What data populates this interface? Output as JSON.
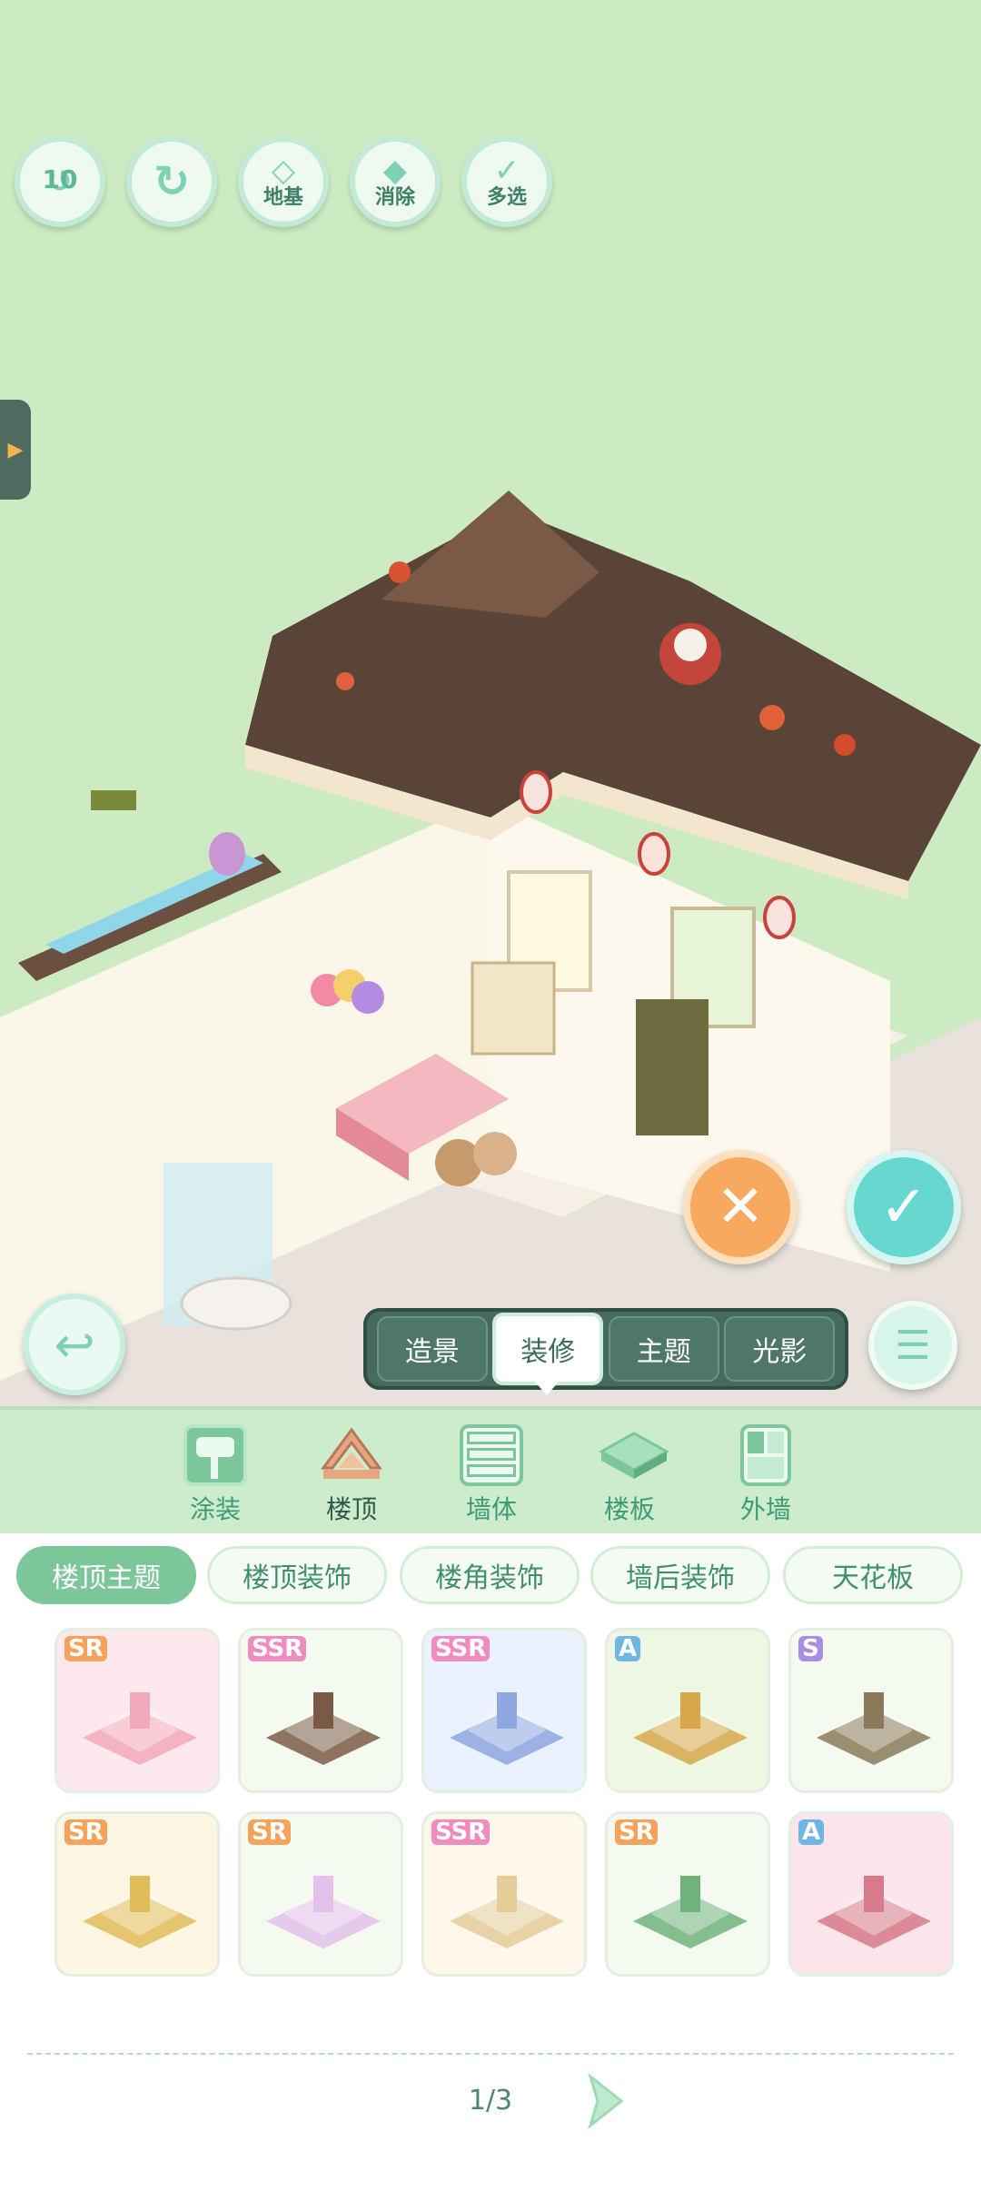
{
  "top_toolbar": {
    "undo_count": "10",
    "foundation_label": "地基",
    "erase_label": "消除",
    "multi_select_label": "多选"
  },
  "modes": [
    "造景",
    "装修",
    "主题",
    "光影"
  ],
  "active_mode": "装修",
  "categories": [
    "涂装",
    "楼顶",
    "墙体",
    "楼板",
    "外墙"
  ],
  "active_category": "楼顶",
  "sub_tabs": [
    "楼顶主题",
    "楼顶装饰",
    "楼角装饰",
    "墙后装饰",
    "天花板"
  ],
  "active_sub_tab": "楼顶主题",
  "items": [
    {
      "rarity": "SR",
      "rarity_color": "#f5a35c",
      "bg": "#fde8ee",
      "icon": "pink-castle-roof"
    },
    {
      "rarity": "SSR",
      "rarity_color": "#f08cc0",
      "bg": "#f4faef",
      "icon": "wooden-bridge-roof"
    },
    {
      "rarity": "SSR",
      "rarity_color": "#f08cc0",
      "bg": "#eaf2fd",
      "icon": "blue-crystal-roof"
    },
    {
      "rarity": "A",
      "rarity_color": "#6fb6e6",
      "bg": "#eef7e2",
      "icon": "gramophone-garden"
    },
    {
      "rarity": "S",
      "rarity_color": "#a98ee0",
      "bg": "#f4faef",
      "icon": "green-pavilion-roof"
    },
    {
      "rarity": "SR",
      "rarity_color": "#f5a35c",
      "bg": "#fdf6e3",
      "icon": "golden-tower-roof"
    },
    {
      "rarity": "SR",
      "rarity_color": "#f5a35c",
      "bg": "#f4faef",
      "icon": "pastel-moon-roof"
    },
    {
      "rarity": "SSR",
      "rarity_color": "#f08cc0",
      "bg": "#fdf7ec",
      "icon": "cream-cloud-roof"
    },
    {
      "rarity": "SR",
      "rarity_color": "#f5a35c",
      "bg": "#f4faef",
      "icon": "tropical-island-roof"
    },
    {
      "rarity": "A",
      "rarity_color": "#6fb6e6",
      "bg": "#fbe4ea",
      "icon": "cherry-blossom-roof"
    }
  ],
  "pagination": {
    "text": "1/3"
  },
  "colors": {
    "background": "#cdebc2",
    "accent_green": "#7cc79a",
    "cancel_orange": "#f7a960",
    "confirm_teal": "#66d8d0"
  }
}
